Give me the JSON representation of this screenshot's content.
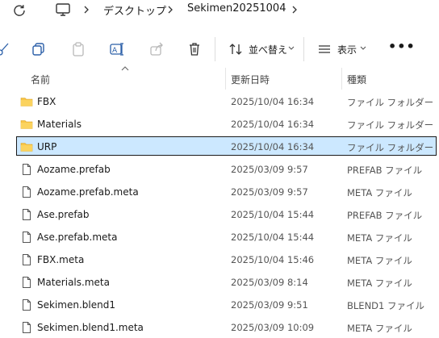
{
  "address_bar": {
    "refresh_icon": "refresh-icon",
    "computer_icon": "computer-icon",
    "breadcrumbs": [
      "デスクトップ",
      "Sekimen20251004"
    ]
  },
  "toolbar": {
    "buttons": [
      "cut-icon",
      "copy-icon",
      "paste-icon",
      "rename-icon",
      "share-icon",
      "delete-icon"
    ],
    "sort_label": "並べ替え",
    "view_label": "表示",
    "more_label": "•••"
  },
  "columns": {
    "name": "名前",
    "date": "更新日時",
    "type": "種類"
  },
  "files": [
    {
      "name": "FBX",
      "date": "2025/10/04 16:34",
      "type": "ファイル フォルダー",
      "kind": "folder",
      "selected": false
    },
    {
      "name": "Materials",
      "date": "2025/10/04 16:34",
      "type": "ファイル フォルダー",
      "kind": "folder",
      "selected": false
    },
    {
      "name": "URP",
      "date": "2025/10/04 16:34",
      "type": "ファイル フォルダー",
      "kind": "folder",
      "selected": true
    },
    {
      "name": "Aozame.prefab",
      "date": "2025/03/09 9:57",
      "type": "PREFAB ファイル",
      "kind": "file",
      "selected": false
    },
    {
      "name": "Aozame.prefab.meta",
      "date": "2025/03/09 9:57",
      "type": "META ファイル",
      "kind": "file",
      "selected": false
    },
    {
      "name": "Ase.prefab",
      "date": "2025/10/04 15:44",
      "type": "PREFAB ファイル",
      "kind": "file",
      "selected": false
    },
    {
      "name": "Ase.prefab.meta",
      "date": "2025/10/04 15:44",
      "type": "META ファイル",
      "kind": "file",
      "selected": false
    },
    {
      "name": "FBX.meta",
      "date": "2025/10/04 15:46",
      "type": "META ファイル",
      "kind": "file",
      "selected": false
    },
    {
      "name": "Materials.meta",
      "date": "2025/03/09 8:14",
      "type": "META ファイル",
      "kind": "file",
      "selected": false
    },
    {
      "name": "Sekimen.blend1",
      "date": "2025/03/09 9:51",
      "type": "BLEND1 ファイル",
      "kind": "file",
      "selected": false
    },
    {
      "name": "Sekimen.blend1.meta",
      "date": "2025/03/09 10:09",
      "type": "META ファイル",
      "kind": "file",
      "selected": false
    }
  ],
  "colors": {
    "folder": "#f8c547",
    "selection": "#cce8ff",
    "accent": "#0067c0"
  }
}
